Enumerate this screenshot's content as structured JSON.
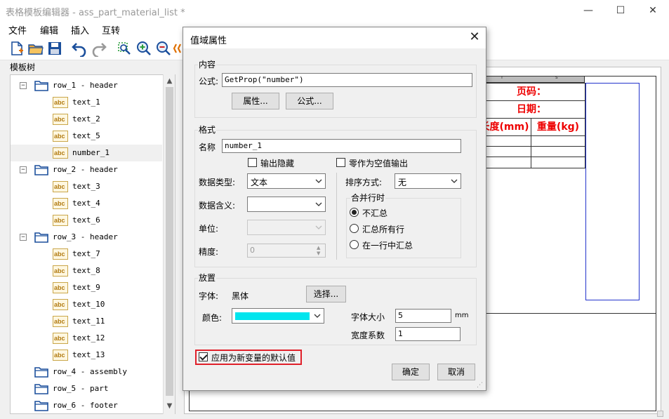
{
  "window": {
    "title": "表格模板编辑器 - ass_part_material_list *",
    "minimize": "—",
    "maximize": "☐",
    "close": "✕"
  },
  "menu": [
    "文件",
    "编辑",
    "插入",
    "互转"
  ],
  "tree": {
    "label": "模板树",
    "items": [
      {
        "label": "row_1 - header",
        "type": "group",
        "expanded": true
      },
      {
        "label": "text_1",
        "type": "leaf"
      },
      {
        "label": "text_2",
        "type": "leaf"
      },
      {
        "label": "text_5",
        "type": "leaf"
      },
      {
        "label": "number_1",
        "type": "leaf",
        "selected": true
      },
      {
        "label": "row_2 - header",
        "type": "group",
        "expanded": true
      },
      {
        "label": "text_3",
        "type": "leaf"
      },
      {
        "label": "text_4",
        "type": "leaf"
      },
      {
        "label": "text_6",
        "type": "leaf"
      },
      {
        "label": "row_3 - header",
        "type": "group",
        "expanded": true
      },
      {
        "label": "text_7",
        "type": "leaf"
      },
      {
        "label": "text_8",
        "type": "leaf"
      },
      {
        "label": "text_9",
        "type": "leaf"
      },
      {
        "label": "text_10",
        "type": "leaf"
      },
      {
        "label": "text_11",
        "type": "leaf"
      },
      {
        "label": "text_12",
        "type": "leaf"
      },
      {
        "label": "text_13",
        "type": "leaf"
      },
      {
        "label": "row_4 - assembly",
        "type": "group",
        "expanded": false
      },
      {
        "label": "row_5 - part",
        "type": "group",
        "expanded": false
      },
      {
        "label": "row_6 - footer",
        "type": "group",
        "expanded": false
      }
    ],
    "leaf_icon_text": "abc"
  },
  "sheet": {
    "page_label": "页码：",
    "date_label": "日期：",
    "length_label": "长度(mm)",
    "weight_label": "重量(kg)",
    "ruler_marks": [
      "r",
      "s"
    ]
  },
  "dialog": {
    "title": "值域属性",
    "content_group": "内容",
    "formula_label": "公式:",
    "formula_value": "GetProp(\"number\")",
    "props_button": "属性...",
    "formula_button": "公式...",
    "format_group": "格式",
    "name_label": "名称",
    "name_value": "number_1",
    "output_hidden_label": "输出隐藏",
    "zero_empty_label": "零作为空值输出",
    "datatype_label": "数据类型:",
    "datatype_value": "文本",
    "sort_label": "排序方式:",
    "sort_value": "无",
    "meaning_label": "数据含义:",
    "meaning_value": "",
    "merge_group": "合并行时",
    "merge_options": [
      "不汇总",
      "汇总所有行",
      "在一行中汇总"
    ],
    "unit_label": "单位:",
    "precision_label": "精度:",
    "precision_value": "0",
    "placement_group": "放置",
    "font_label": "字体:",
    "font_value": "黑体",
    "choose_button": "选择...",
    "color_label": "颜色:",
    "color_value": "#00e5ee",
    "fontsize_label": "字体大小",
    "fontsize_value": "5",
    "fontsize_unit": "mm",
    "widthfactor_label": "宽度系数",
    "widthfactor_value": "1",
    "default_label": "应用为新变量的默认值",
    "ok_button": "确定",
    "cancel_button": "取消"
  }
}
